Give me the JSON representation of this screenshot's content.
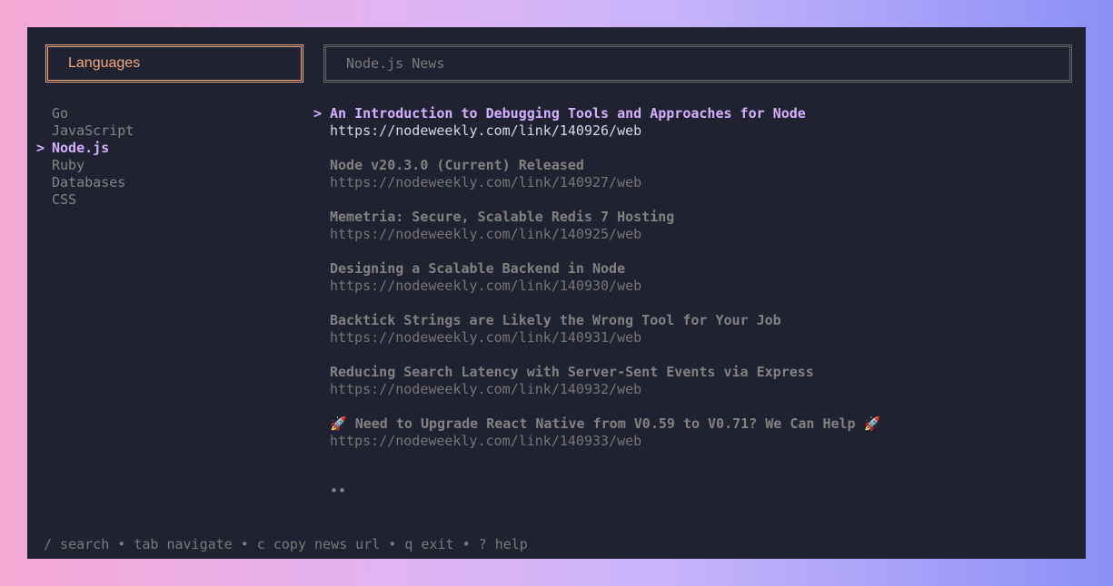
{
  "panels": {
    "languages_title": "Languages",
    "news_title": "Node.js News"
  },
  "cursor": ">",
  "languages": [
    {
      "label": "Go",
      "selected": false
    },
    {
      "label": "JavaScript",
      "selected": false
    },
    {
      "label": "Node.js",
      "selected": true
    },
    {
      "label": "Ruby",
      "selected": false
    },
    {
      "label": "Databases",
      "selected": false
    },
    {
      "label": "CSS",
      "selected": false
    }
  ],
  "news": [
    {
      "title": "An Introduction to Debugging Tools and Approaches for Node",
      "url": "https://nodeweekly.com/link/140926/web",
      "selected": true
    },
    {
      "title": "Node v20.3.0 (Current) Released",
      "url": "https://nodeweekly.com/link/140927/web",
      "selected": false
    },
    {
      "title": "Memetria: Secure, Scalable Redis 7 Hosting",
      "url": "https://nodeweekly.com/link/140925/web",
      "selected": false
    },
    {
      "title": "Designing a Scalable Backend in Node",
      "url": "https://nodeweekly.com/link/140930/web",
      "selected": false
    },
    {
      "title": "Backtick Strings are Likely the Wrong Tool for Your Job",
      "url": "https://nodeweekly.com/link/140931/web",
      "selected": false
    },
    {
      "title": "Reducing Search Latency with Server-Sent Events via Express",
      "url": "https://nodeweekly.com/link/140932/web",
      "selected": false
    },
    {
      "title": "🚀 Need to Upgrade React Native from V0.59 to V0.71? We Can Help 🚀",
      "url": "https://nodeweekly.com/link/140933/web",
      "selected": false
    }
  ],
  "pager": "••",
  "help": "/ search • tab navigate • c copy news url • q exit • ? help"
}
